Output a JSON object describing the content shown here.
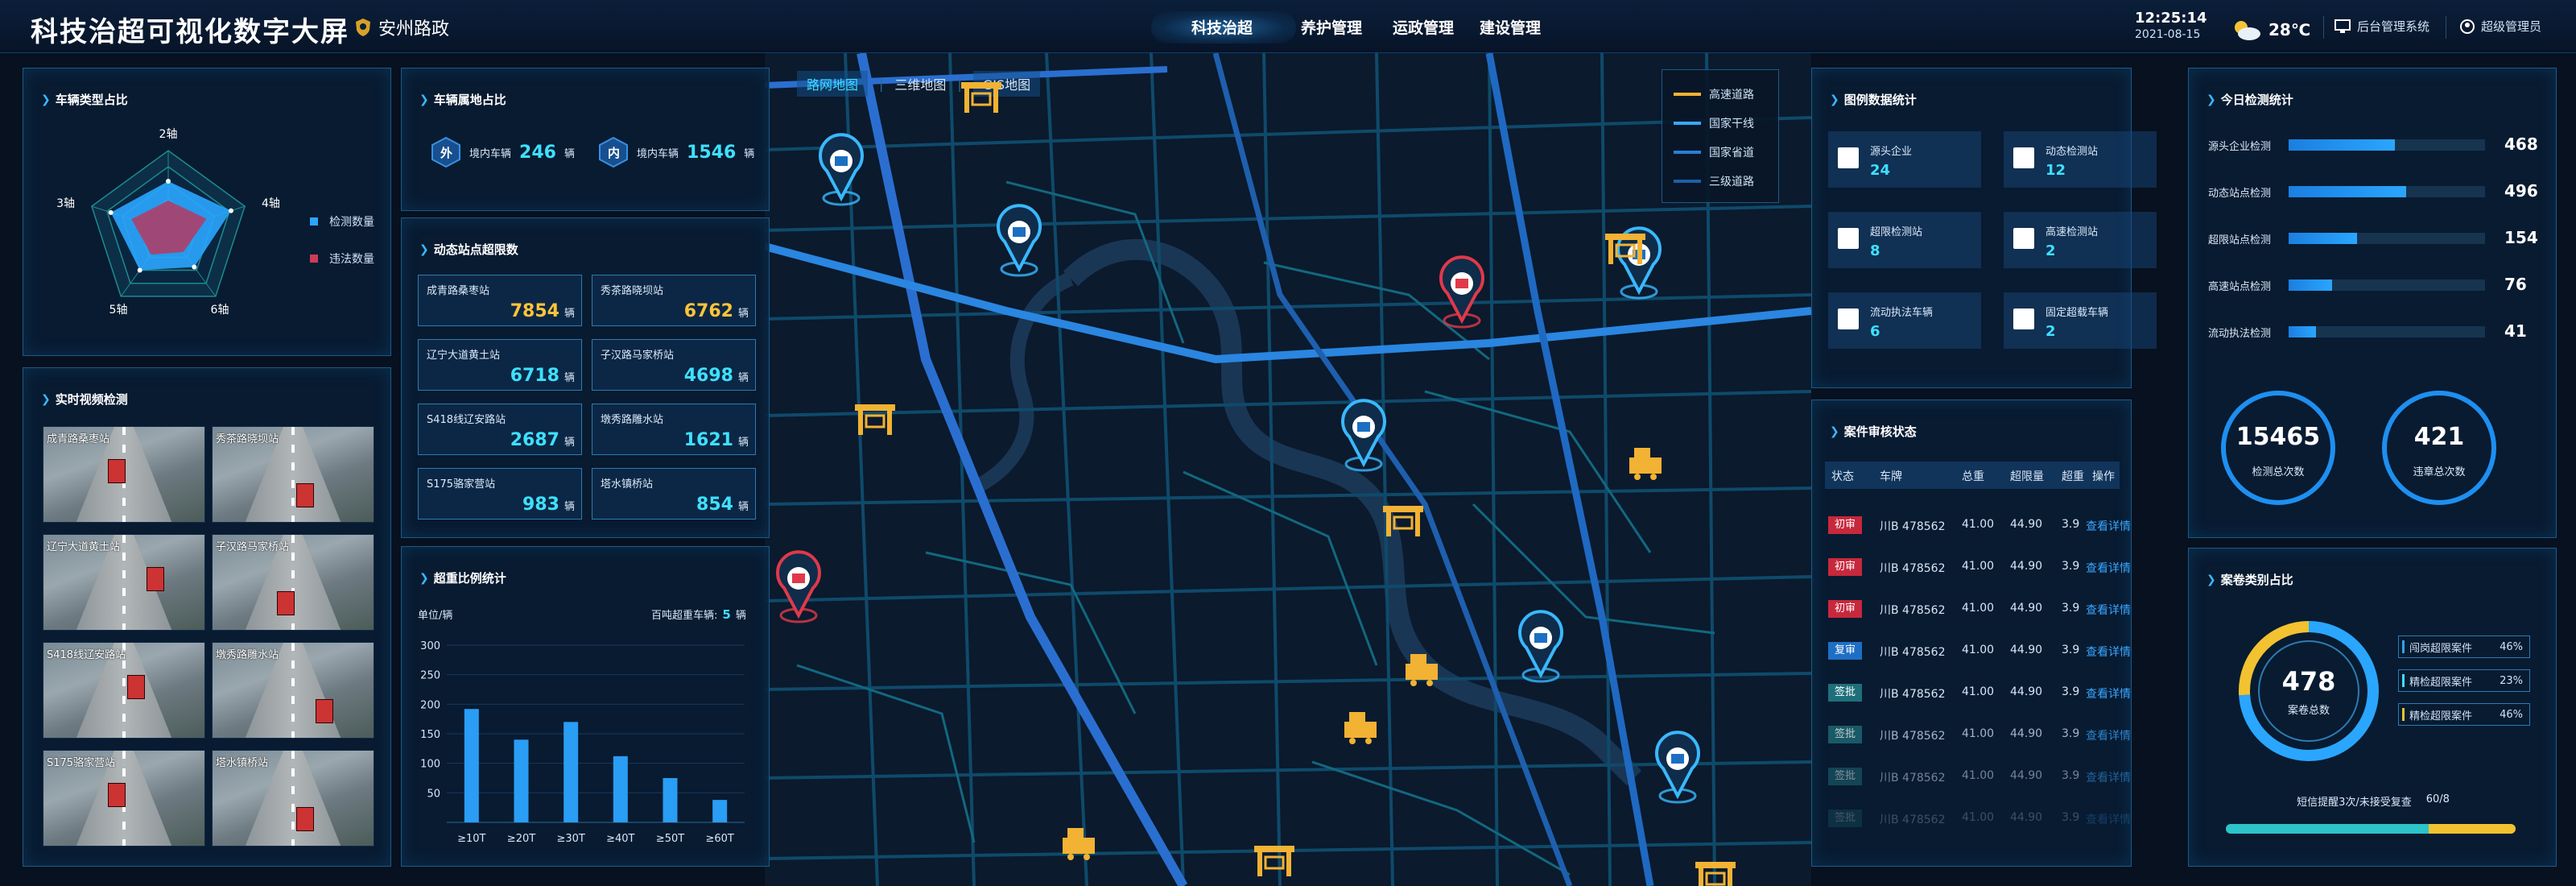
{
  "header": {
    "title": "科技治超可视化数字大屏",
    "brand": "安州路政",
    "nav": [
      "科技治超",
      "养护管理",
      "运政管理",
      "建设管理"
    ],
    "time": "12:25:14",
    "date": "2021-08-15",
    "temp": "28℃",
    "admin_link": "后台管理系统",
    "user": "超级管理员"
  },
  "vehicle_type": {
    "title": "车辆类型占比",
    "axes": [
      "2轴",
      "4轴",
      "6轴",
      "5轴",
      "3轴"
    ],
    "legend": [
      "检测数量",
      "违法数量"
    ],
    "colors": {
      "detect": "#2aa6ff",
      "illegal": "#d03b5a"
    }
  },
  "video": {
    "title": "实时视频检测",
    "cams": [
      "成青路桑枣站",
      "秀茶路晓坝站",
      "辽宁大道黄土站",
      "子汉路马家桥站",
      "S418线辽安路站",
      "墩秀路雕水站",
      "S175骆家营站",
      "塔水镇桥站"
    ]
  },
  "origin": {
    "title": "车辆属地占比",
    "outside_badge": "外",
    "outside_label": "境内车辆",
    "outside_value": "246",
    "outside_unit": "辆",
    "inside_badge": "内",
    "inside_label": "境内车辆",
    "inside_value": "1546",
    "inside_unit": "辆"
  },
  "overload_stations": {
    "title": "动态站点超限数",
    "items": [
      {
        "name": "成青路桑枣站",
        "value": "7854",
        "unit": "辆"
      },
      {
        "name": "秀茶路晓坝站",
        "value": "6762",
        "unit": "辆"
      },
      {
        "name": "辽宁大道黄土站",
        "value": "6718",
        "unit": "辆"
      },
      {
        "name": "子汉路马家桥站",
        "value": "4698",
        "unit": "辆"
      },
      {
        "name": "S418线辽安路站",
        "value": "2687",
        "unit": "辆"
      },
      {
        "name": "墩秀路雕水站",
        "value": "1621",
        "unit": "辆"
      },
      {
        "name": "S175骆家营站",
        "value": "983",
        "unit": "辆"
      },
      {
        "name": "塔水镇桥站",
        "value": "854",
        "unit": "辆"
      }
    ]
  },
  "ratio": {
    "title": "超重比例统计",
    "unit_label": "单位/辆",
    "hundred_label": "百吨超重车辆:",
    "hundred_value": "5",
    "hundred_unit": "辆"
  },
  "chart_data": {
    "type": "bar",
    "categories": [
      "≥10T",
      "≥20T",
      "≥30T",
      "≥40T",
      "≥50T",
      "≥60T"
    ],
    "values": [
      192,
      140,
      170,
      112,
      75,
      38
    ],
    "ylim": [
      0,
      300
    ],
    "yticks": [
      "300",
      "250",
      "200",
      "150",
      "100",
      "50"
    ]
  },
  "map": {
    "tabs": [
      "路网地图",
      "三维地图",
      "GIS地图"
    ],
    "legend": [
      {
        "label": "高速道路",
        "color": "#f2b233"
      },
      {
        "label": "国家干线",
        "color": "#3aa6ff"
      },
      {
        "label": "国家省道",
        "color": "#2a7fd6"
      },
      {
        "label": "三级道路",
        "color": "#1f5fa8"
      }
    ]
  },
  "layer_stats": {
    "title": "图例数据统计",
    "items": [
      {
        "label": "源头企业",
        "value": "24"
      },
      {
        "label": "动态检测站",
        "value": "12"
      },
      {
        "label": "超限检测站",
        "value": "8"
      },
      {
        "label": "高速检测站",
        "value": "2"
      },
      {
        "label": "流动执法车辆",
        "value": "6"
      },
      {
        "label": "固定超载车辆",
        "value": "2"
      }
    ]
  },
  "case_status": {
    "title": "案件审核状态",
    "headers": [
      "状态",
      "车牌",
      "总重",
      "超限量",
      "超重",
      "操作"
    ],
    "rows": [
      {
        "status": "初审",
        "plate": "川B 478562",
        "total": "41.00",
        "limit": "44.90",
        "over": "3.9",
        "op": "查看详情",
        "color": "#c7283c"
      },
      {
        "status": "初审",
        "plate": "川B 478562",
        "total": "41.00",
        "limit": "44.90",
        "over": "3.9",
        "op": "查看详情",
        "color": "#c7283c"
      },
      {
        "status": "初审",
        "plate": "川B 478562",
        "total": "41.00",
        "limit": "44.90",
        "over": "3.9",
        "op": "查看详情",
        "color": "#c7283c"
      },
      {
        "status": "复审",
        "plate": "川B 478562",
        "total": "41.00",
        "limit": "44.90",
        "over": "3.9",
        "op": "查看详情",
        "color": "#1e6fc4"
      },
      {
        "status": "签批",
        "plate": "川B 478562",
        "total": "41.00",
        "limit": "44.90",
        "over": "3.9",
        "op": "查看详情",
        "color": "#1f6f7a"
      },
      {
        "status": "签批",
        "plate": "川B 478562",
        "total": "41.00",
        "limit": "44.90",
        "over": "3.9",
        "op": "查看详情",
        "color": "#1f6f7a"
      },
      {
        "status": "签批",
        "plate": "川B 478562",
        "total": "41.00",
        "limit": "44.90",
        "over": "3.9",
        "op": "查看详情",
        "color": "#1f6f7a"
      },
      {
        "status": "签批",
        "plate": "川B 478562",
        "total": "41.00",
        "limit": "44.90",
        "over": "3.9",
        "op": "查看详情",
        "color": "#1f6f7a"
      }
    ]
  },
  "today": {
    "title": "今日检测统计",
    "items": [
      {
        "label": "源头企业检测",
        "value": "468",
        "pct": 0.54
      },
      {
        "label": "动态站点检测",
        "value": "496",
        "pct": 0.6
      },
      {
        "label": "超限站点检测",
        "value": "154",
        "pct": 0.35
      },
      {
        "label": "高速站点检测",
        "value": "76",
        "pct": 0.22
      },
      {
        "label": "流动执法检测",
        "value": "41",
        "pct": 0.14
      }
    ],
    "total_detect": "15465",
    "total_detect_label": "检测总次数",
    "total_illegal": "421",
    "total_illegal_label": "违章总次数"
  },
  "case_type": {
    "title": "案卷类别占比",
    "total": "478",
    "total_label": "案卷总数",
    "items": [
      {
        "label": "闯岗超限案件",
        "pct": "46%",
        "color": "#2aa6ff"
      },
      {
        "label": "精检超限案件",
        "pct": "23%",
        "color": "#3ee0ff"
      },
      {
        "label": "精检超限案件",
        "pct": "46%",
        "color": "#f2c230"
      }
    ],
    "footer_label": "短信提醒3次/未接受复查",
    "footer_value": "60/8"
  }
}
